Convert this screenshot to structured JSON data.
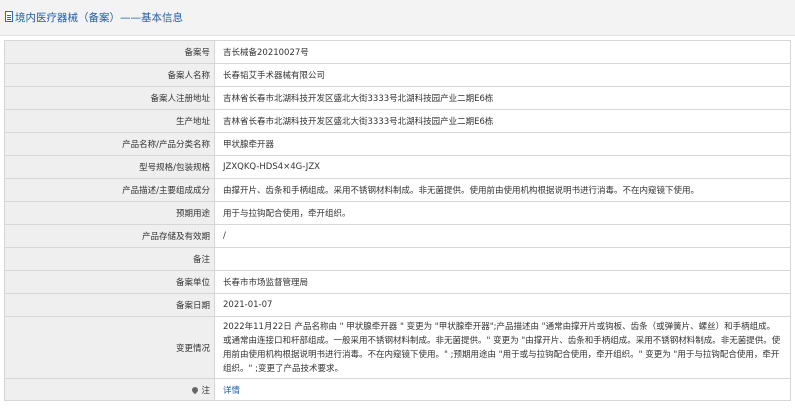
{
  "header": {
    "title": "境内医疗器械（备案）——基本信息"
  },
  "rows": [
    {
      "label": "备案号",
      "value": "吉长械备20210027号"
    },
    {
      "label": "备案人名称",
      "value": "长春韬艾手术器械有限公司"
    },
    {
      "label": "备案人注册地址",
      "value": "吉林省长春市北湖科技开发区盛北大街3333号北湖科技园产业二期E6栋"
    },
    {
      "label": "生产地址",
      "value": "吉林省长春市北湖科技开发区盛北大街3333号北湖科技园产业二期E6栋"
    },
    {
      "label": "产品名称/产品分类名称",
      "value": "甲状腺牵开器"
    },
    {
      "label": "型号规格/包装规格",
      "value": "JZXQKQ-HDS4×4G-JZX"
    },
    {
      "label": "产品描述/主要组成成分",
      "value": "由撑开片、齿条和手柄组成。采用不锈钢材料制成。非无菌提供。使用前由使用机构根据说明书进行消毒。不在内窥镜下使用。"
    },
    {
      "label": "预期用途",
      "value": "用于与拉钩配合使用，牵开组织。"
    },
    {
      "label": "产品存储及有效期",
      "value": "/"
    },
    {
      "label": "备注",
      "value": ""
    },
    {
      "label": "备案单位",
      "value": "长春市市场监督管理局"
    },
    {
      "label": "备案日期",
      "value": "2021-01-07"
    }
  ],
  "change": {
    "label": "变更情况",
    "value": "2022年11月22日 产品名称由 \" 甲状腺牵开器 \" 变更为 \"甲状腺牵开器\";产品描述由 \"通常由撑开片或钩板、齿条（或弹簧片、螺丝）和手柄组成。或通常由连接口和杆部组成。一般采用不锈钢材料制成。非无菌提供。\" 变更为 \"由撑开片、齿条和手柄组成。采用不锈钢材料制成。非无菌提供。使用前由使用机构根据说明书进行消毒。不在内窥镜下使用。\" ;预期用途由 \"用于或与拉钩配合使用，牵开组织。\" 变更为 \"用于与拉钩配合使用，牵开组织。\" ;变更了产品技术要求。"
  },
  "note": {
    "label": "注",
    "link_text": "详情"
  }
}
